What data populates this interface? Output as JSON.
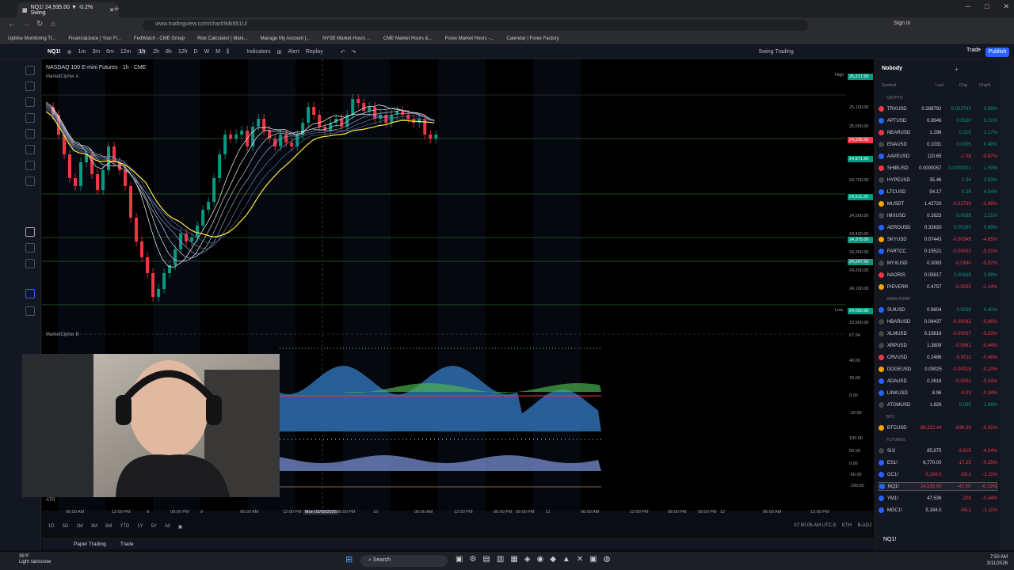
{
  "browser": {
    "tab_title": "NQ1! 24,935.00 ▼ -0.2% Swing",
    "url": "www.tradingview.com/chart/9dk651U/",
    "bookmarks": [
      "Uptime Monitoring Tr...",
      "FinancialJuice | Your Fi...",
      "FedWatch - CME Group",
      "Risk Calculator | Mark...",
      "Manage My Account |...",
      "NYSE Market Hours ...",
      "CME Market Hours &...",
      "Forex Market Hours -...",
      "Calendar | Forex Factory"
    ]
  },
  "toolbar": {
    "symbol": "NQ1!",
    "intervals": [
      "1m",
      "3m",
      "6m",
      "12m",
      "1h",
      "2h",
      "8h",
      "12h",
      "D",
      "W",
      "M"
    ],
    "indicators": "Indicators",
    "alert": "Alert",
    "replay": "Replay",
    "layout_name": "Swing Trading",
    "trade": "Trade",
    "publish": "Publish",
    "sign_in": "Sign in"
  },
  "chart": {
    "title": "NASDAQ 100 E-mini Futures · 1h · CME",
    "sub_indicator": "MarketCipher A",
    "indicator_b": "MarketCipher B",
    "atr": "ATR",
    "price_labels": [
      "25,100.00",
      "25,000.00",
      "24,900.00",
      "24,700.00",
      "24,500.00",
      "24,400.00",
      "24,300.00",
      "24,200.00",
      "24,100.00",
      "23,900.00"
    ],
    "price_tags": [
      {
        "text": "25,217.50",
        "color": "#089981"
      },
      {
        "text": "24,935.00",
        "color": "#f23645"
      },
      {
        "text": "24,871.50",
        "color": "#089981"
      },
      {
        "text": "24,611.25",
        "color": "#089981"
      },
      {
        "text": "24,375.00",
        "color": "#089981"
      },
      {
        "text": "24,247.50",
        "color": "#089981"
      },
      {
        "text": "24,000.00",
        "color": "#089981"
      }
    ],
    "high_label": "High",
    "low_label": "Low",
    "osc_labels": [
      "60.00",
      "40.00",
      "20.00",
      "0.00",
      "-20.00"
    ],
    "osc_value": "67.94",
    "osc2_labels": [
      "100.00",
      "50.00",
      "0.00",
      "-50.00",
      "-100.00"
    ],
    "time_labels": [
      "06:00 AM",
      "12:00 PM",
      "8",
      "09:00 PM",
      "9",
      "06:00 AM",
      "12:00 PM",
      "Mon 03/09/2026",
      "05:00 PM",
      "10",
      "06:00 AM",
      "12:00 PM",
      "06:00 PM",
      "09:00 PM",
      "11",
      "06:00 AM",
      "12:00 PM",
      "06:00 PM",
      "09:00 PM",
      "12",
      "06:00 AM",
      "12:00 PM"
    ],
    "ranges": [
      "1D",
      "5D",
      "1M",
      "3M",
      "6M",
      "YTD",
      "1Y",
      "5Y",
      "All"
    ],
    "clock": "07:50:05 AM UTC-5",
    "session": "ETH",
    "adj": "B-ADJ"
  },
  "bottom": {
    "items": [
      "Paper Trading",
      "Trade"
    ]
  },
  "watchlist": {
    "title": "Nobody",
    "columns": [
      "Symbol",
      "Last",
      "Chg",
      "Chg%"
    ],
    "sections": [
      {
        "name": "CRYPTO",
        "rows": [
          {
            "s": "TRXUSD",
            "l": "0.288792",
            "c": "0.002793",
            "p": "0.98%",
            "col": "#f23645",
            "up": true
          },
          {
            "s": "APTUSD",
            "l": "0.9546",
            "c": "0.0020",
            "p": "0.21%",
            "col": "#2962ff",
            "up": true
          },
          {
            "s": "NEARUSD",
            "l": "1.298",
            "c": "0.015",
            "p": "1.17%",
            "col": "#f23645",
            "up": true
          },
          {
            "s": "ENAUSD",
            "l": "0.1031",
            "c": "0.0005",
            "p": "0.49%",
            "col": "#444",
            "up": true
          },
          {
            "s": "AAVEUSD",
            "l": "110.65",
            "c": "-1.08",
            "p": "-0.97%",
            "col": "#2962ff",
            "up": false
          },
          {
            "s": "SHIBUSD",
            "l": "0.0000057",
            "c": "0.0000001",
            "p": "1.59%",
            "col": "#f23645",
            "up": true
          },
          {
            "s": "HYPEUSD",
            "l": "35.46",
            "c": "1.34",
            "p": "3.93%",
            "col": "#444",
            "up": true
          },
          {
            "s": "LTCUSD",
            "l": "54.17",
            "c": "0.29",
            "p": "0.54%",
            "col": "#2962ff",
            "up": true
          },
          {
            "s": "MUSDT",
            "l": "1.42720",
            "c": "-0.02739",
            "p": "-1.88%",
            "col": "#f7a600",
            "up": false
          },
          {
            "s": "IMXUSD",
            "l": "0.1623",
            "c": "0.0035",
            "p": "2.21%",
            "col": "#444",
            "up": true
          },
          {
            "s": "AEROUSD",
            "l": "0.33830",
            "c": "0.00297",
            "p": "0.89%",
            "col": "#2962ff",
            "up": true
          },
          {
            "s": "SKYUSD",
            "l": "0.07443",
            "c": "-0.00345",
            "p": "-4.65%",
            "col": "#f7a600",
            "up": false
          },
          {
            "s": "FARTCC",
            "l": "0.15521",
            "c": "-0.00002",
            "p": "-0.01%",
            "col": "#2962ff",
            "up": false
          },
          {
            "s": "MYXUSD",
            "l": "0.3083",
            "c": "-0.0180",
            "p": "-5.52%",
            "col": "#444",
            "up": false
          },
          {
            "s": "NAORIS",
            "l": "0.05817",
            "c": "0.00169",
            "p": "2.99%",
            "col": "#f23645",
            "up": true
          },
          {
            "s": "PIEVERR",
            "l": "0.4757",
            "c": "-0.0055",
            "p": "-1.14%",
            "col": "#f7a600",
            "up": false
          }
        ]
      },
      {
        "name": "XMAS PUMP",
        "rows": [
          {
            "s": "SUIUSD",
            "l": "0.9604",
            "c": "0.0038",
            "p": "0.40%",
            "col": "#2962ff",
            "up": true
          },
          {
            "s": "HBARUSD",
            "l": "0.09437",
            "c": "-0.00082",
            "p": "-0.86%",
            "col": "#444",
            "up": false
          },
          {
            "s": "XLMUSD",
            "l": "0.15818",
            "c": "-0.00037",
            "p": "-0.23%",
            "col": "#444",
            "up": false
          },
          {
            "s": "XRPUSD",
            "l": "1.3809",
            "c": "-0.0061",
            "p": "-0.44%",
            "col": "#444",
            "up": false
          },
          {
            "s": "CRVUSD",
            "l": "0.2486",
            "c": "-0.0011",
            "p": "-0.46%",
            "col": "#f23645",
            "up": false
          },
          {
            "s": "DOGEUSD",
            "l": "0.09025",
            "c": "-0.00018",
            "p": "-0.20%",
            "col": "#f7a600",
            "up": false
          },
          {
            "s": "ADAUSD",
            "l": "0.2618",
            "c": "-0.0001",
            "p": "-0.04%",
            "col": "#2962ff",
            "up": false
          },
          {
            "s": "LINKUSD",
            "l": "8.96",
            "c": "-0.03",
            "p": "-0.34%",
            "col": "#2962ff",
            "up": false
          },
          {
            "s": "ATOMUSD",
            "l": "1.826",
            "c": "0.035",
            "p": "1.96%",
            "col": "#444",
            "up": true
          }
        ]
      },
      {
        "name": "BTC",
        "rows": [
          {
            "s": "BTCUSD",
            "l": "69,322.44",
            "c": "-638.39",
            "p": "-0.91%",
            "col": "#f7a600",
            "up": false
          }
        ]
      },
      {
        "name": "FUTURES",
        "rows": [
          {
            "s": "SI1!",
            "l": "85,975",
            "c": "-3,615",
            "p": "-4.04%",
            "col": "#444",
            "up": false
          },
          {
            "s": "ES1!",
            "l": "6,770.00",
            "c": "-17.25",
            "p": "-0.25%",
            "col": "#2962ff",
            "up": false
          },
          {
            "s": "GC1!",
            "l": "5,184.0",
            "c": "-58.1",
            "p": "-1.11%",
            "col": "#2962ff",
            "up": false
          },
          {
            "s": "NQ1!",
            "l": "24,935.00",
            "c": "-47.50",
            "p": "-0.19%",
            "col": "#2962ff",
            "up": false
          },
          {
            "s": "YM1!",
            "l": "47,536",
            "c": "-209",
            "p": "-0.44%",
            "col": "#2962ff",
            "up": false
          },
          {
            "s": "MGC1!",
            "l": "5,184.0",
            "c": "-58.1",
            "p": "-1.11%",
            "col": "#2962ff",
            "up": false
          }
        ]
      }
    ],
    "footer_symbol": "NQ1!"
  },
  "taskbar": {
    "weather_temp": "35°F",
    "weather_desc": "Light rain/snow",
    "search": "Search",
    "time": "7:50 AM",
    "date": "3/11/2026"
  },
  "colors": {
    "up": "#089981",
    "down": "#f23645",
    "accent": "#2962ff",
    "bg": "#000000"
  }
}
